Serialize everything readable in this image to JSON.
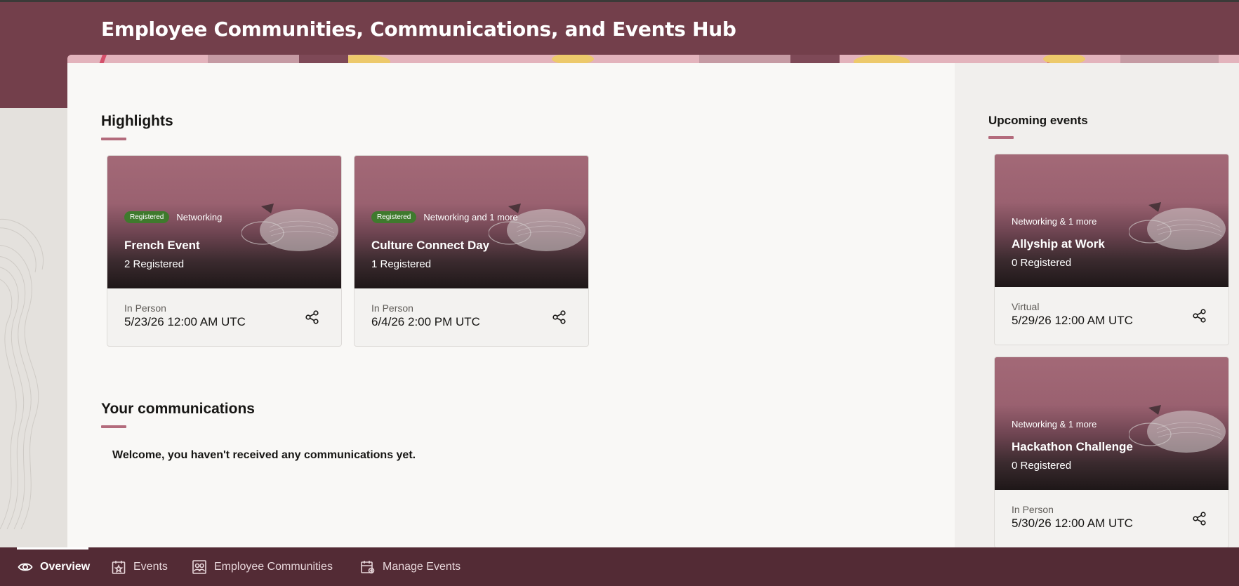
{
  "app": {
    "title": "Employee Communities, Communications, and Events Hub"
  },
  "colors": {
    "header": "#733f4b",
    "accent": "#b36b7c",
    "nav": "#532b35",
    "registered_chip": "#3f7a2d"
  },
  "highlights": {
    "title": "Highlights",
    "cards": [
      {
        "chip": "Registered",
        "tags": "Networking",
        "name": "French Event",
        "registered": "2 Registered",
        "mode": "In Person",
        "datetime": "5/23/26 12:00 AM UTC",
        "share_icon": "share-icon"
      },
      {
        "chip": "Registered",
        "tags": "Networking and 1 more",
        "name": "Culture Connect Day",
        "registered": "1 Registered",
        "mode": "In Person",
        "datetime": "6/4/26 2:00 PM UTC",
        "share_icon": "share-icon"
      }
    ]
  },
  "communications": {
    "title": "Your communications",
    "empty_message": "Welcome, you haven't received any communications yet."
  },
  "upcoming": {
    "title": "Upcoming events",
    "cards": [
      {
        "tags": "Networking & 1 more",
        "name": "Allyship at Work",
        "registered": "0 Registered",
        "mode": "Virtual",
        "datetime": "5/29/26 12:00 AM UTC"
      },
      {
        "tags": "Networking & 1 more",
        "name": "Hackathon Challenge",
        "registered": "0 Registered",
        "mode": "In Person",
        "datetime": "5/30/26 12:00 AM UTC"
      }
    ]
  },
  "bottom_nav": {
    "items": [
      {
        "label": "Overview",
        "icon": "eye-icon",
        "active": true
      },
      {
        "label": "Events",
        "icon": "calendar-star-icon",
        "active": false
      },
      {
        "label": "Employee Communities",
        "icon": "community-icon",
        "active": false
      },
      {
        "label": "Manage Events",
        "icon": "calendar-gear-icon",
        "active": false
      }
    ]
  }
}
